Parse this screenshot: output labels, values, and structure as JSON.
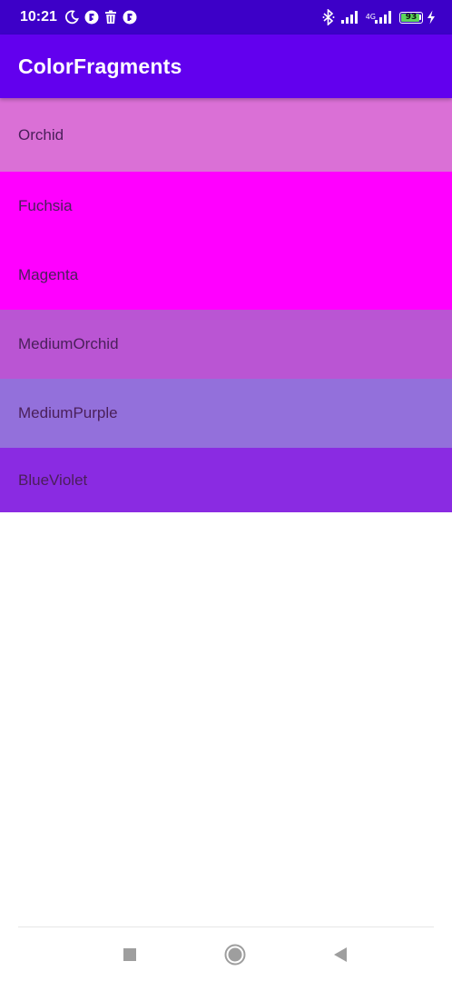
{
  "status_bar": {
    "time": "10:21",
    "network_label": "4G",
    "battery_level": "93",
    "battery_percent": 93,
    "icons": [
      "moon-icon",
      "app-notification-icon",
      "trash-icon",
      "app-notification-icon",
      "bluetooth-icon",
      "signal-icon",
      "signal-4g-icon",
      "battery-icon",
      "charging-icon"
    ]
  },
  "app_bar": {
    "title": "ColorFragments",
    "color": "#6200ee"
  },
  "colors": [
    {
      "label": "Orchid",
      "color": "#da70d6"
    },
    {
      "label": "Fuchsia",
      "color": "#ff00ff"
    },
    {
      "label": "Magenta",
      "color": "#ff00ff"
    },
    {
      "label": "MediumOrchid",
      "color": "#ba55d3"
    },
    {
      "label": "MediumPurple",
      "color": "#9370db"
    },
    {
      "label": "BlueViolet",
      "color": "#8a2be2"
    }
  ],
  "nav_bar": {
    "buttons": [
      "recents-square-icon",
      "home-circle-icon",
      "back-triangle-icon"
    ]
  }
}
